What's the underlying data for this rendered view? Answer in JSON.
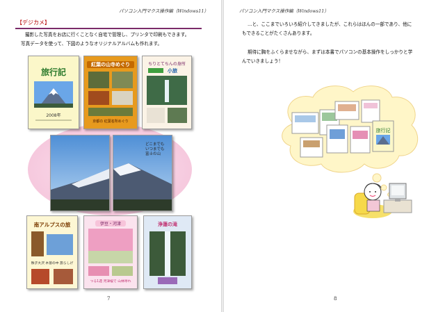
{
  "left_page": {
    "running_head": "パソコン入門マクス操作編（Windows11）",
    "heading": "【デジカメ】",
    "body_lines": [
      "撮影した写真をお店に行くことなく自宅で管理し、プリンタで印刷もできます。",
      "写真データを使って、下図のようなオリジナルアルバムも作れます。"
    ],
    "album": {
      "travel_title": "旅行記",
      "travel_year": "2008年",
      "waterfall_title": "ちりとてちんの身所",
      "waterfall_badge": "小旅",
      "walk_title": "紅葉の山寺めぐり",
      "walk_caption": "京都の 紅葉名所めぐり",
      "fuji_caption_lines": [
        "どこまでも",
        "いつまでも",
        "富士の山"
      ],
      "alps_title": "南アルプスの旅",
      "alps_caption": "秩子大沢 木曽の中 旅らしげ",
      "sakura_title": "伊豆・河津",
      "sakura_caption": "つる1週 河津桜で 山林呼れ",
      "falls_title": "浄蓮の滝"
    },
    "page_number": "7"
  },
  "right_page": {
    "running_head": "パソコン入門マクス操作編（Windows11）",
    "body_lines": [
      "…と、ここまでいろいろ紹介してきましたが、これらはほんの一部であり、他に",
      "もできることがたくさんあります。",
      "期待に胸をふくらませながら、まずは本書でパソコンの基本操作をしっかりと学",
      "んでいきましょう！"
    ],
    "bubble_card_title": "旅行記",
    "page_number": "8"
  },
  "colors": {
    "heading": "#b40000",
    "rule": "#7a2a68",
    "pink_circle": "#f6c9de",
    "thought_bubble": "#fff6c8"
  }
}
